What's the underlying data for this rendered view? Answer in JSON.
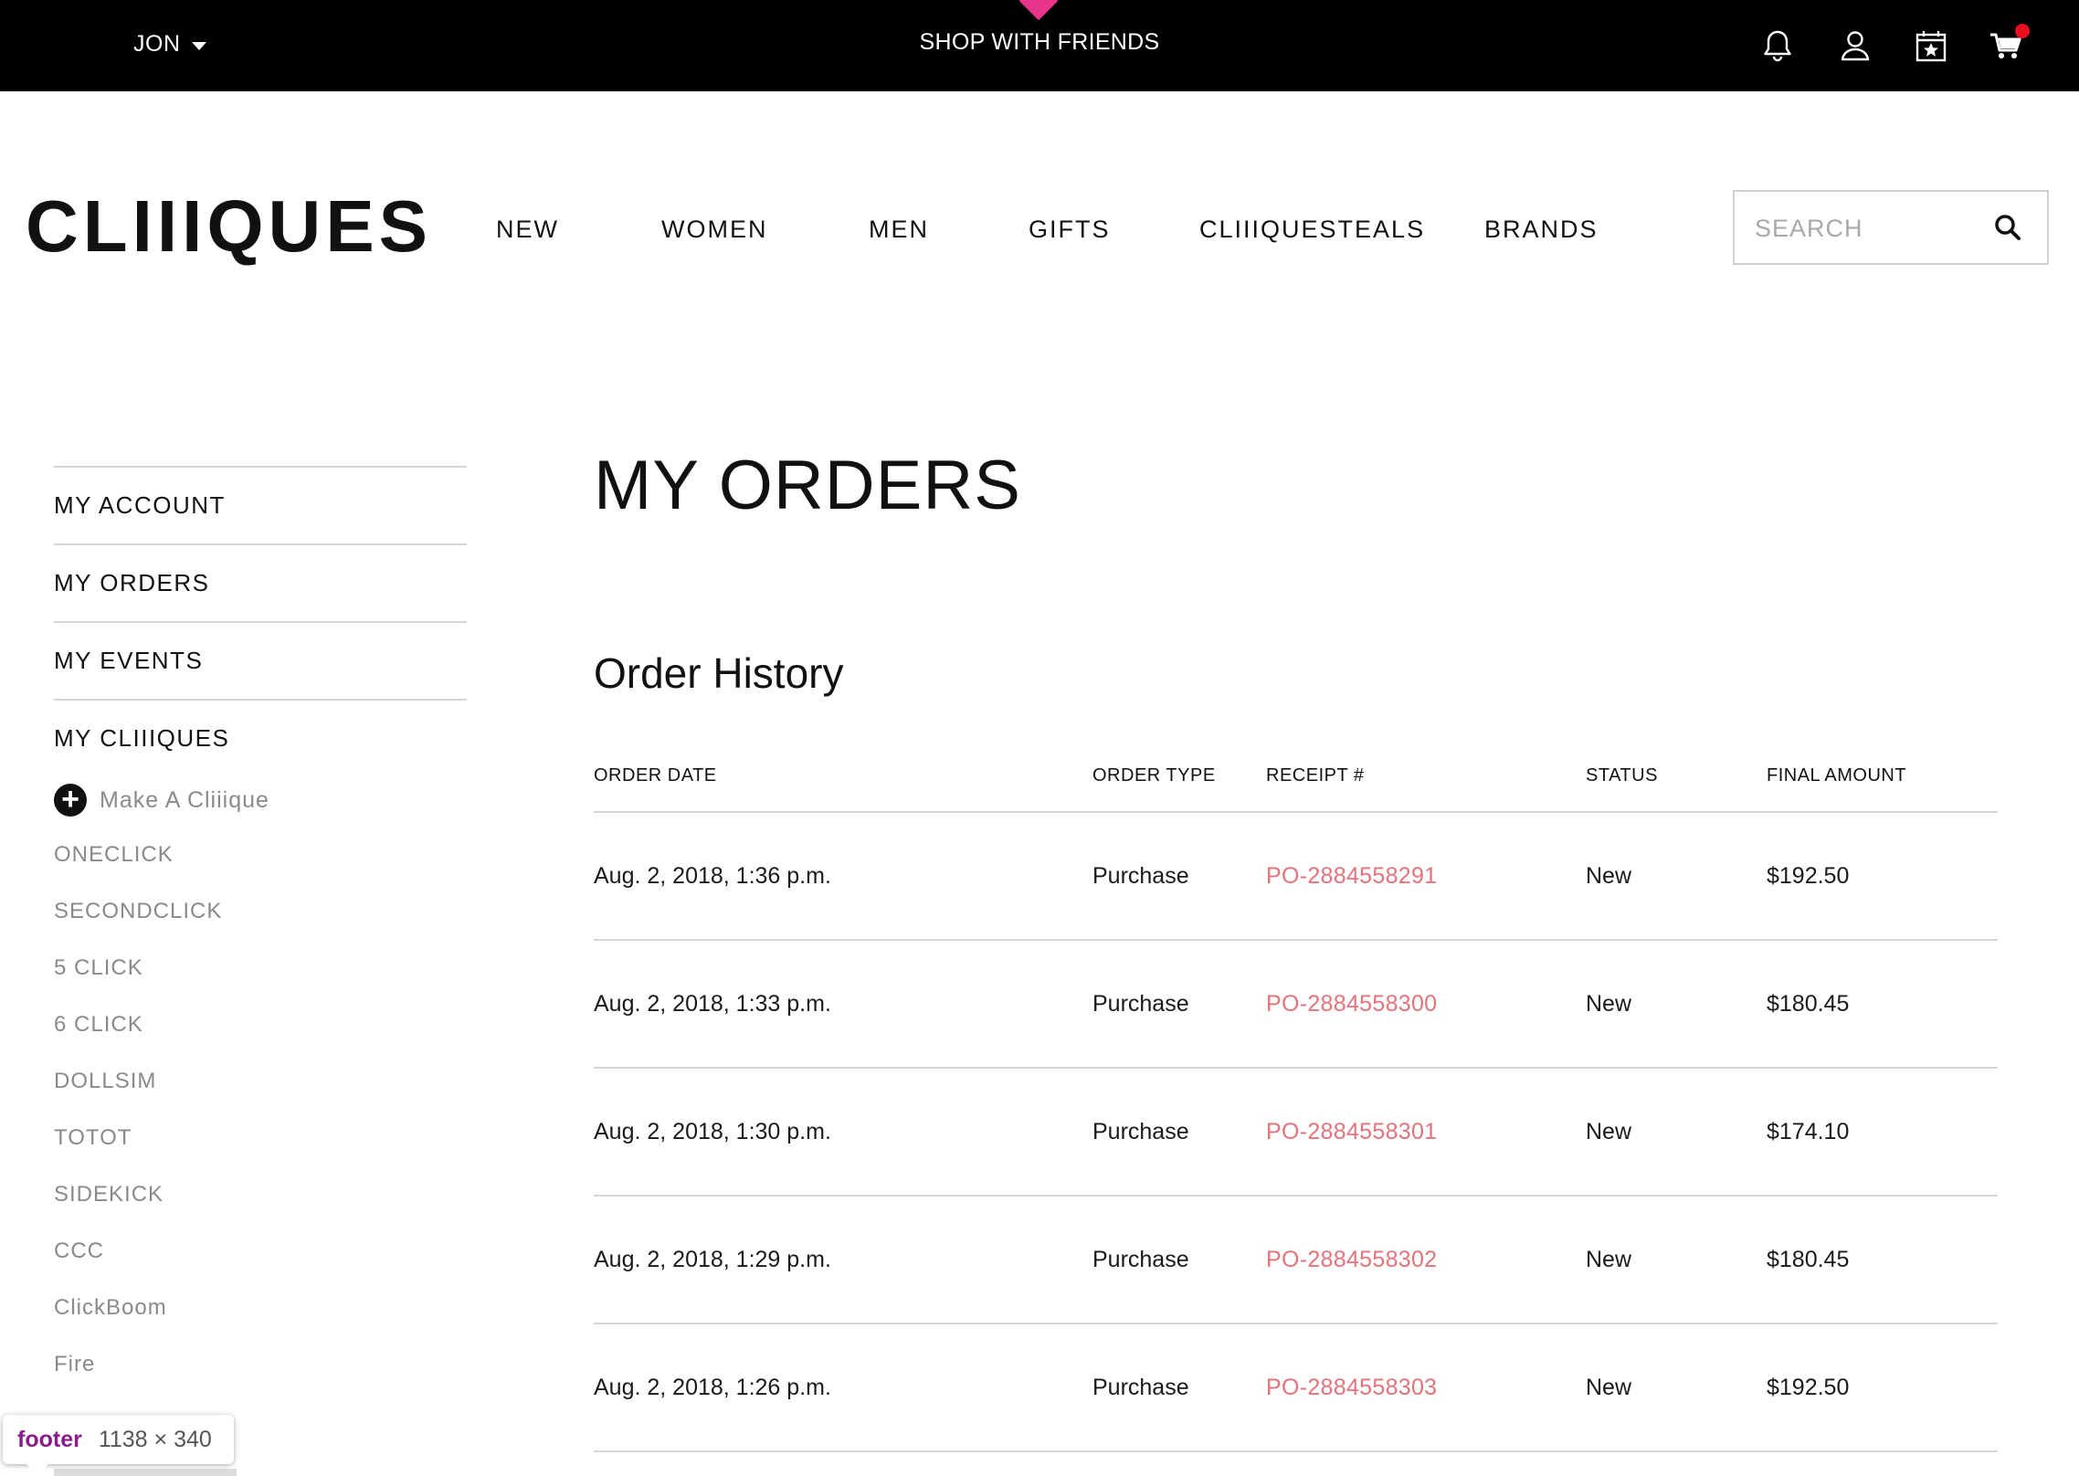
{
  "topbar": {
    "user_label": "JON",
    "center_link": "SHOP WITH FRIENDS",
    "icons": [
      "bell-icon",
      "user-icon",
      "calendar-star-icon",
      "cart-icon"
    ],
    "accent_color": "#e8348a",
    "cart_badge_color": "#e8101e"
  },
  "header": {
    "logo": "CLIIIQUES",
    "nav": [
      "NEW",
      "WOMEN",
      "MEN",
      "GIFTS",
      "CLIIIQUESTEALS",
      "BRANDS"
    ],
    "search": {
      "placeholder": "SEARCH",
      "value": ""
    }
  },
  "sidebar": {
    "items": [
      "MY ACCOUNT",
      "MY ORDERS",
      "MY EVENTS",
      "MY CLIIIQUES"
    ],
    "make_clique": "Make A Cliiique",
    "cliques": [
      "ONECLICK",
      "SECONDCLICK",
      "5 CLICK",
      "6 CLICK",
      "DOLLSIM",
      "TOTOT",
      "SIDEKICK",
      "CCC",
      "ClickBoom",
      "Fire"
    ]
  },
  "main": {
    "page_title": "MY ORDERS",
    "section_title": "Order History",
    "columns": [
      "ORDER DATE",
      "ORDER TYPE",
      "RECEIPT #",
      "STATUS",
      "FINAL AMOUNT"
    ],
    "orders": [
      {
        "date": "Aug. 2, 2018, 1:36 p.m.",
        "type": "Purchase",
        "receipt": "PO-2884558291",
        "status": "New",
        "amount": "$192.50"
      },
      {
        "date": "Aug. 2, 2018, 1:33 p.m.",
        "type": "Purchase",
        "receipt": "PO-2884558300",
        "status": "New",
        "amount": "$180.45"
      },
      {
        "date": "Aug. 2, 2018, 1:30 p.m.",
        "type": "Purchase",
        "receipt": "PO-2884558301",
        "status": "New",
        "amount": "$174.10"
      },
      {
        "date": "Aug. 2, 2018, 1:29 p.m.",
        "type": "Purchase",
        "receipt": "PO-2884558302",
        "status": "New",
        "amount": "$180.45"
      },
      {
        "date": "Aug. 2, 2018, 1:26 p.m.",
        "type": "Purchase",
        "receipt": "PO-2884558303",
        "status": "New",
        "amount": "$192.50"
      }
    ],
    "receipt_link_color": "#e4737b"
  },
  "devtools_tooltip": {
    "tag": "footer",
    "size": "1138 × 340"
  }
}
